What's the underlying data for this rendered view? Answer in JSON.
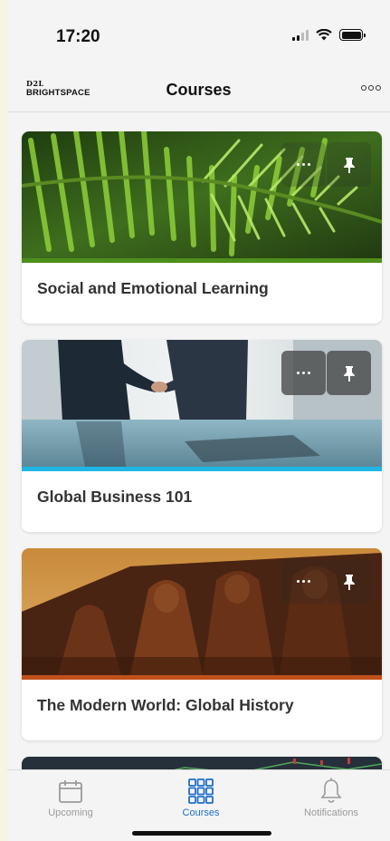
{
  "status_bar": {
    "time": "17:20",
    "icons": [
      "cellular-signal-icon",
      "wifi-icon",
      "battery-icon"
    ]
  },
  "header": {
    "brand_top": "D2L",
    "brand_name": "BRIGHTSPACE",
    "title": "Courses",
    "menu_icon": "more-options-icon"
  },
  "courses": [
    {
      "title": "Social and Emotional Learning",
      "accent_color": "#4d8f1b",
      "image": "fern-leaf-image"
    },
    {
      "title": "Global Business 101",
      "accent_color": "#1fb6e6",
      "image": "handshake-image"
    },
    {
      "title": "The Modern World: Global History",
      "accent_color": "#c0501a",
      "image": "temple-statues-image"
    }
  ],
  "card_actions": {
    "menu_icon": "more-options-icon",
    "pin_icon": "pin-icon"
  },
  "tab_bar": {
    "tabs": [
      {
        "label": "Upcoming",
        "icon": "calendar-icon",
        "active": false
      },
      {
        "label": "Courses",
        "icon": "grid-icon",
        "active": true
      },
      {
        "label": "Notifications",
        "icon": "bell-icon",
        "active": false
      }
    ]
  },
  "colors": {
    "accent": "#1e6fcc",
    "inactive_tab": "#9a9a9a",
    "background": "#f4f4f4"
  }
}
